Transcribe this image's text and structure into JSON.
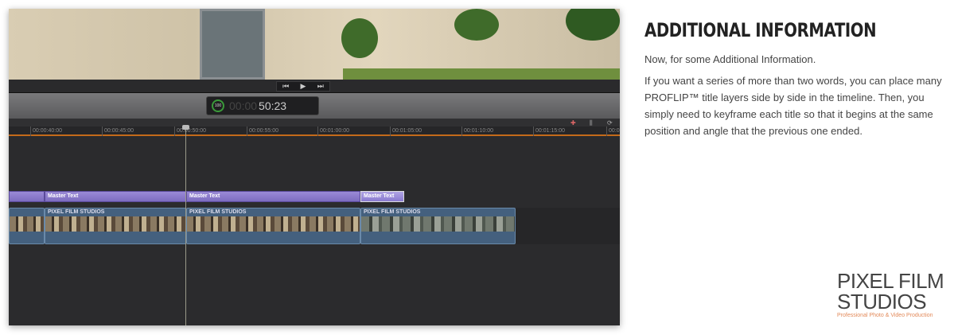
{
  "player": {
    "controls": {
      "prev": "⏮",
      "play": "▶",
      "next": "⏭"
    },
    "timecode": {
      "zoom": "100",
      "dim": "00:00",
      "value": "50:23"
    }
  },
  "timeline": {
    "ruler_ticks": [
      "00:00:40:00",
      "00:00:45:00",
      "00:00:50:00",
      "00:00:55:00",
      "00:01:00:00",
      "00:01:05:00",
      "00:01:10:00",
      "00:01:15:00",
      "00:0"
    ],
    "titles": [
      "Master Text",
      "Master Text",
      "Master Text"
    ],
    "clips": [
      "PIXEL FILM STUDIOS",
      "PIXEL FILM STUDIOS",
      "PIXEL FILM STUDIOS"
    ]
  },
  "info": {
    "heading": "ADDITIONAL INFORMATION",
    "intro": "Now, for some Additional Information.",
    "body": "If you want a series of more than two words, you can place many PROFLIP™ title layers side by side in the timeline. Then, you simply need to keyframe each title so that it begins at the same position and angle that the previous one ended."
  },
  "logo": {
    "line1": "PIXEL FILM",
    "line2": "STUDIOS",
    "tagline": "Professional Photo & Video Production"
  }
}
